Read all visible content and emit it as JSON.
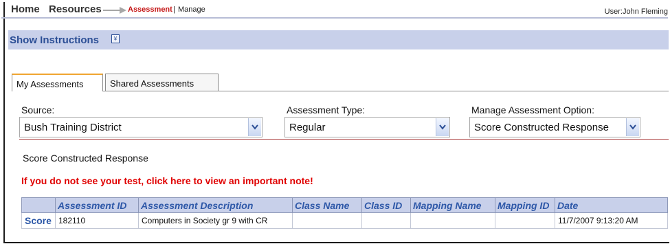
{
  "breadcrumb": {
    "home": "Home",
    "resources": "Resources",
    "current": "Assessment",
    "separator": "|",
    "manage": "Manage"
  },
  "user": {
    "label": "User:John Fleming"
  },
  "instructions": {
    "label": "Show Instructions",
    "toggle_glyph": "¥"
  },
  "tabs": [
    {
      "label": "My Assessments",
      "active": true
    },
    {
      "label": "Shared Assessments",
      "active": false
    }
  ],
  "filters": {
    "source": {
      "label": "Source:",
      "value": "Bush Training District"
    },
    "assessment_type": {
      "label": "Assessment Type:",
      "value": "Regular"
    },
    "manage_option": {
      "label": "Manage Assessment Option:",
      "value": "Score Constructed Response"
    }
  },
  "section": {
    "title": "Score Constructed Response",
    "note": "If you do not see your test, click here to view an important note!"
  },
  "table": {
    "columns": [
      "",
      "Assessment ID",
      "Assessment Description",
      "Class Name",
      "Class ID",
      "Mapping Name",
      "Mapping ID",
      "Date"
    ],
    "rows": [
      [
        "Score",
        "182110",
        "Computers in Society gr 9 with CR",
        "",
        "",
        "",
        "",
        "11/7/2007 9:13:20 AM"
      ]
    ]
  },
  "colors": {
    "header_bg": "#c8d0ea",
    "header_text": "#2e58a8",
    "alert_red": "#e00000",
    "tab_accent": "#f0a531"
  }
}
